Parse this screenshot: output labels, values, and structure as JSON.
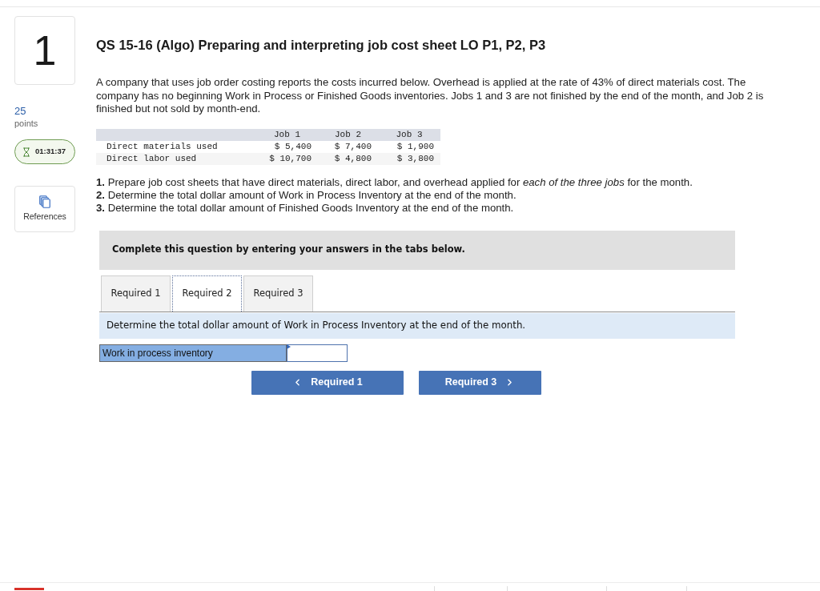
{
  "question": {
    "number": "1",
    "points_value": "25",
    "points_label": "points",
    "timer": "01:31:37",
    "references_label": "References"
  },
  "title": "QS 15-16 (Algo) Preparing and interpreting job cost sheet LO P1, P2, P3",
  "intro": "A company that uses job order costing reports the costs incurred below. Overhead is applied at the rate of 43% of direct materials cost. The company has no beginning Work in Process or Finished Goods inventories. Jobs 1 and 3 are not finished by the end of the month, and Job 2 is finished but not sold by month-end.",
  "cost_table": {
    "columns": [
      "Job 1",
      "Job 2",
      "Job 3"
    ],
    "rows": [
      {
        "label": "Direct materials used",
        "values": [
          "$ 5,400",
          "$ 7,400",
          "$ 1,900"
        ]
      },
      {
        "label": "Direct labor used",
        "values": [
          "$ 10,700",
          "$ 4,800",
          "$ 3,800"
        ]
      }
    ]
  },
  "instructions": [
    "**1.** Prepare job cost sheets that have direct materials, direct labor, and overhead applied for *each of the three jobs* for the month.",
    "**2.** Determine the total dollar amount of Work in Process Inventory at the end of the month.",
    "**3.** Determine the total dollar amount of Finished Goods Inventory at the end of the month."
  ],
  "banner": "Complete this question by entering your answers in the tabs below.",
  "tabs": [
    {
      "label": "Required 1",
      "selected": false
    },
    {
      "label": "Required 2",
      "selected": true
    },
    {
      "label": "Required 3",
      "selected": false
    }
  ],
  "prompt": "Determine the total dollar amount of Work in Process Inventory at the end of the month.",
  "answer_row": {
    "label": "Work in process inventory"
  },
  "nav_buttons": [
    {
      "kind": "prev",
      "label": "Required 1"
    },
    {
      "kind": "next",
      "label": "Required 3"
    }
  ]
}
